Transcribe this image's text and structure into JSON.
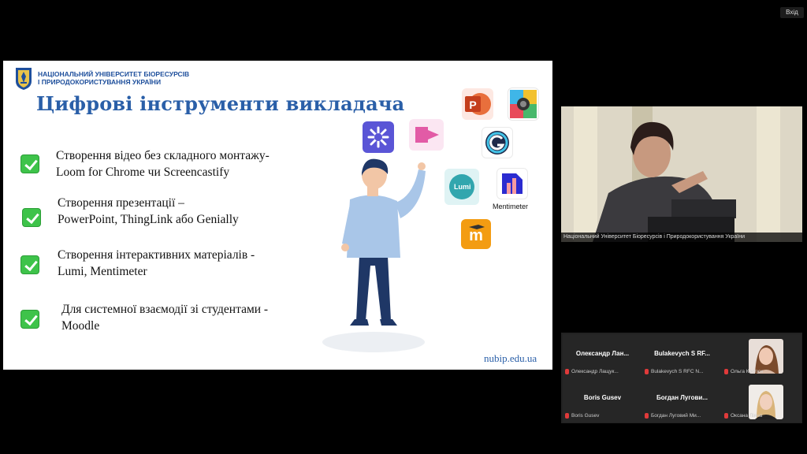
{
  "window": {
    "exit_label": "Вхід"
  },
  "slide": {
    "university_line1": "НАЦІОНАЛЬНИЙ УНІВЕРСИТЕТ БІОРЕСУРСІВ",
    "university_line2": "І ПРИРОДОКОРИСТУВАННЯ УКРАЇНИ",
    "title": "Цифрові інструменти викладача",
    "bullets": [
      {
        "line1": "Створення відео без складного монтажу-",
        "line2": "Loom for Chrome чи Screencastify"
      },
      {
        "line1": "Створення презентації –",
        "line2": "PowerPoint, ThingLink або Genially"
      },
      {
        "line1": "Створення інтерактивних матеріалів -",
        "line2": "Lumi, Mentimeter"
      },
      {
        "line1": "Для системної взаємодії зі студентами -",
        "line2": "Moodle"
      }
    ],
    "url": "nubip.edu.ua",
    "tool_labels": {
      "lumi": "Lumi",
      "mentimeter": "Mentimeter"
    }
  },
  "speaker": {
    "caption": "Національний Університет Біоресурсів і Природокористування України"
  },
  "participants": [
    {
      "name": "Олександр Лан...",
      "caption": "Олександр Лащук..."
    },
    {
      "name": "Bulakevych S RF...",
      "caption": "Bulakevych S RFC N..."
    },
    {
      "name": "",
      "caption": "Ольга Костюк"
    },
    {
      "name": "Boris Gusev",
      "caption": "Boris Gusev"
    },
    {
      "name": "Богдан Лугови...",
      "caption": "Богдан Луговий Ми..."
    },
    {
      "name": "",
      "caption": "Оксана Ліяна"
    }
  ],
  "colors": {
    "title_blue": "#2a5fa8",
    "check_green": "#3ec34a",
    "mic_muted_red": "#e03a3a"
  }
}
